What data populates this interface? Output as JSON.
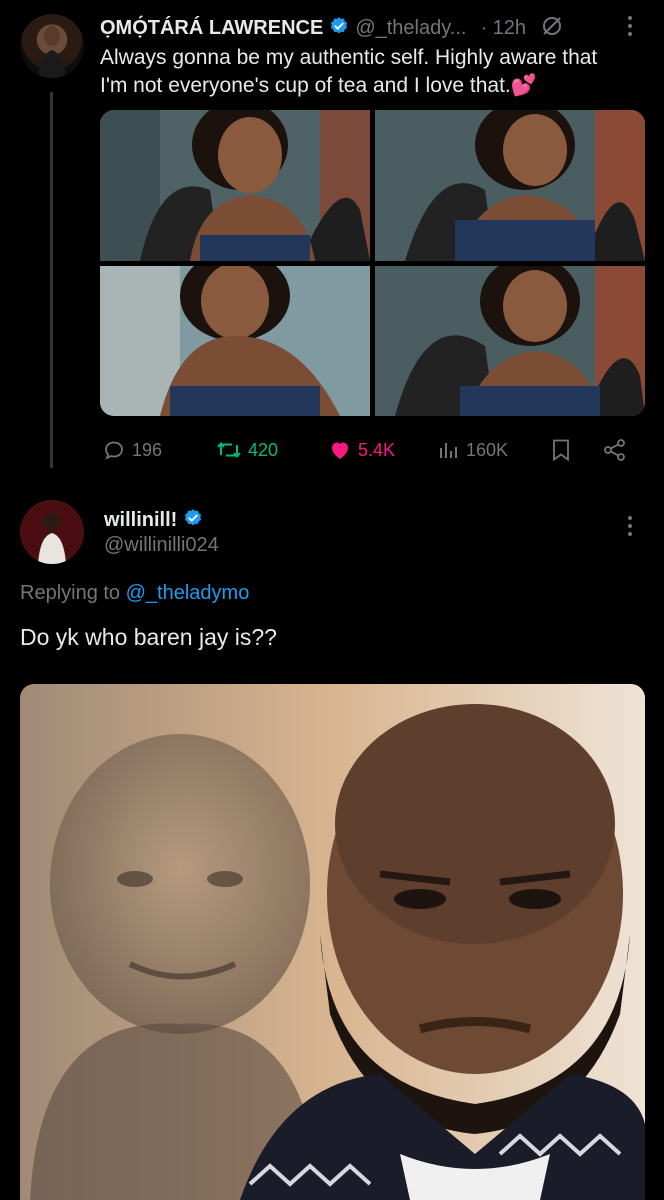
{
  "tweet": {
    "author_name": "ỌMỌ́TÁRÁ LAWRENCE",
    "author_handle": "@_thelady...",
    "time": "· 12h",
    "text_line1": "Always gonna be my authentic self. Highly aware that",
    "text_line2": "I'm not everyone's cup of tea and I love that.",
    "emoji": "💕",
    "stats": {
      "replies": "196",
      "retweets": "420",
      "likes": "5.4K",
      "views": "160K"
    }
  },
  "reply": {
    "author_name": "willinill!",
    "author_handle": "@willinilli024",
    "replying_to_prefix": "Replying to",
    "replying_to_handle": "@_theladymo",
    "text": "Do yk who baren jay is??"
  },
  "colors": {
    "background": "#000000",
    "text": "#e7e9ea",
    "muted": "#71767b",
    "verified": "#1d9bf0",
    "retweet": "#00ba7c",
    "like": "#f91880",
    "link": "#1d9bf0"
  }
}
